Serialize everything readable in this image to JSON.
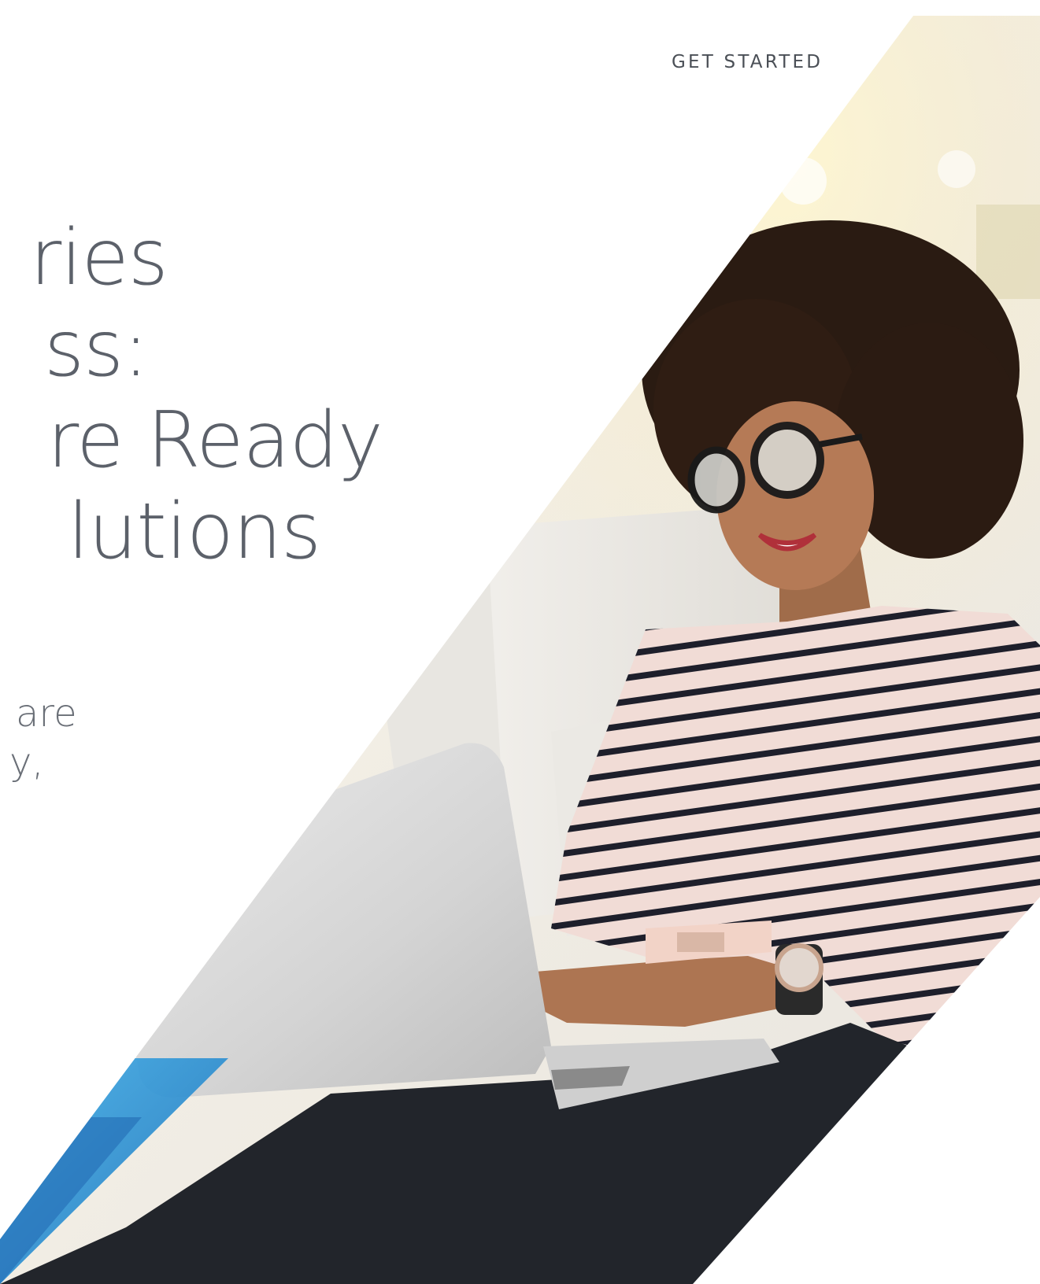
{
  "nav": {
    "get_started": "GET STARTED"
  },
  "hero": {
    "title_lines": [
      "ries",
      "ss:",
      "re Ready",
      "lutions"
    ],
    "subtext_lines": [
      "are",
      "y,"
    ]
  },
  "colors": {
    "teal_accent": "#13b3c9",
    "blue_accent": "#2d8fd6",
    "text_gray": "#5c616a"
  }
}
